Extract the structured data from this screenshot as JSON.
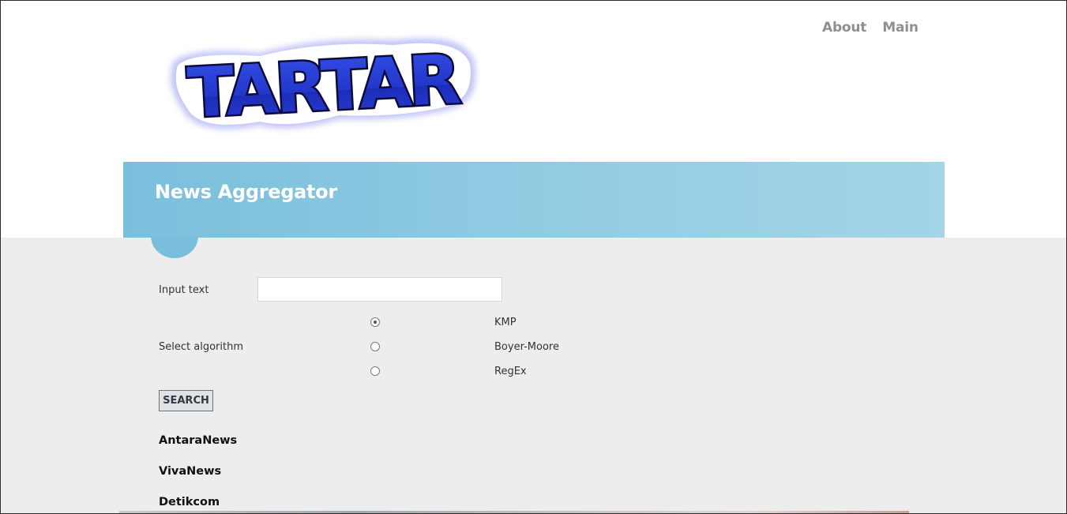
{
  "nav": {
    "items": [
      {
        "label": "About"
      },
      {
        "label": "Main"
      }
    ]
  },
  "logo": {
    "text": "TARTAR",
    "colors": {
      "fill": "#2a3fd6",
      "outline": "#0a0a3a",
      "glow": "#8d8fef"
    }
  },
  "banner": {
    "title": "News Aggregator",
    "color": "#79bfdc"
  },
  "form": {
    "input_label": "Input text",
    "input_value": "",
    "input_placeholder": "",
    "algorithm_label": "Select algorithm",
    "algorithms": [
      {
        "label": "KMP",
        "checked": true
      },
      {
        "label": "Boyer-Moore",
        "checked": false
      },
      {
        "label": "RegEx",
        "checked": false
      }
    ],
    "search_label": "SEARCH"
  },
  "sources": [
    {
      "label": "AntaraNews"
    },
    {
      "label": "VivaNews"
    },
    {
      "label": "Detikcom"
    }
  ]
}
